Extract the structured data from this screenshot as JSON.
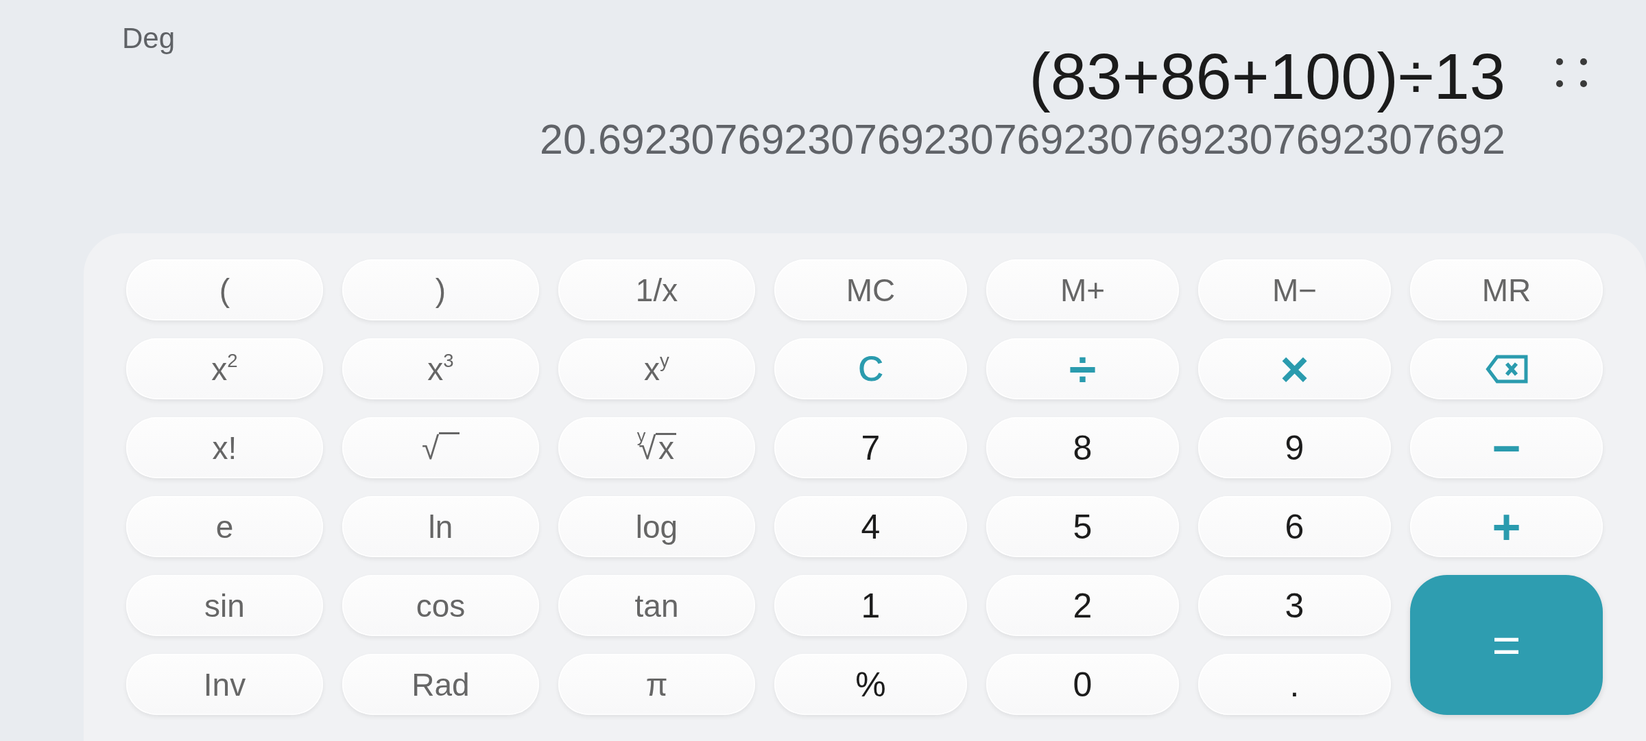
{
  "angle_mode": {
    "label": "Deg"
  },
  "display": {
    "expression": "(83+86+100)÷13",
    "result": "20.692307692307692307692307692307692307692"
  },
  "keys": [
    {
      "label": "(",
      "kind": "function"
    },
    {
      "label": ")",
      "kind": "function"
    },
    {
      "label": "1/x",
      "kind": "function"
    },
    {
      "label": "MC",
      "kind": "function"
    },
    {
      "label": "M+",
      "kind": "function"
    },
    {
      "label": "M−",
      "kind": "function"
    },
    {
      "label": "MR",
      "kind": "function"
    },
    {
      "label": "x$^{2}$",
      "kind": "function"
    },
    {
      "label": "x$^{3}$",
      "kind": "function"
    },
    {
      "label": "x$^{y}$",
      "kind": "function"
    },
    {
      "label": "C",
      "kind": "clear"
    },
    {
      "label": "÷",
      "kind": "operator"
    },
    {
      "label": "×",
      "kind": "operator"
    },
    {
      "kind": "backspace"
    },
    {
      "label": "x!",
      "kind": "function"
    },
    {
      "label": "√",
      "kind": "root"
    },
    {
      "label": "$^{y}$√",
      "radicand": "x",
      "kind": "root"
    },
    {
      "label": "7",
      "kind": "digit"
    },
    {
      "label": "8",
      "kind": "digit"
    },
    {
      "label": "9",
      "kind": "digit"
    },
    {
      "label": "−",
      "kind": "operator"
    },
    {
      "label": "e",
      "kind": "function"
    },
    {
      "label": "ln",
      "kind": "function"
    },
    {
      "label": "log",
      "kind": "function"
    },
    {
      "label": "4",
      "kind": "digit"
    },
    {
      "label": "5",
      "kind": "digit"
    },
    {
      "label": "6",
      "kind": "digit"
    },
    {
      "label": "+",
      "kind": "operator"
    },
    {
      "label": "sin",
      "kind": "function"
    },
    {
      "label": "cos",
      "kind": "function"
    },
    {
      "label": "tan",
      "kind": "function"
    },
    {
      "label": "1",
      "kind": "digit"
    },
    {
      "label": "2",
      "kind": "digit"
    },
    {
      "label": "3",
      "kind": "digit"
    },
    {
      "label": "=",
      "kind": "equals"
    },
    {
      "label": "Inv",
      "kind": "function"
    },
    {
      "label": "Rad",
      "kind": "function"
    },
    {
      "label": "π",
      "kind": "function"
    },
    {
      "label": "%",
      "kind": "digit"
    },
    {
      "label": "0",
      "kind": "digit"
    },
    {
      "label": ".",
      "kind": "digit"
    }
  ]
}
